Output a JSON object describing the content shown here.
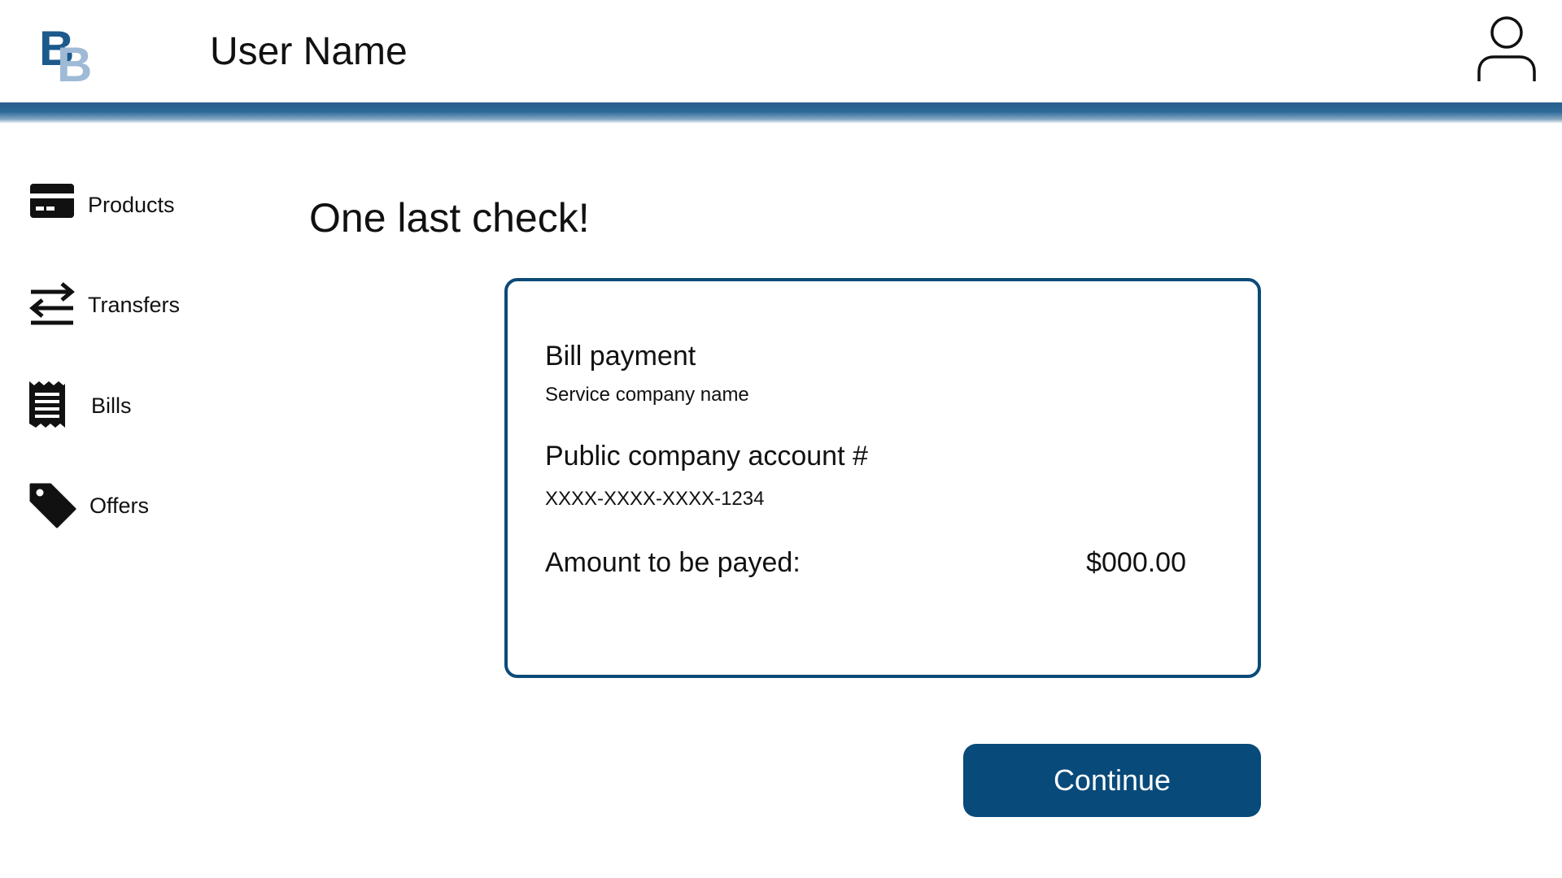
{
  "header": {
    "logo_text_primary": "B",
    "logo_text_secondary": "B",
    "user_name": "User Name",
    "profile_icon": "user-profile-icon"
  },
  "sidebar": {
    "items": [
      {
        "label": "Products",
        "icon": "credit-card-icon"
      },
      {
        "label": "Transfers",
        "icon": "transfer-arrows-icon"
      },
      {
        "label": "Bills",
        "icon": "receipt-icon"
      },
      {
        "label": "Offers",
        "icon": "tag-icon"
      }
    ]
  },
  "main": {
    "title": "One last check!",
    "card": {
      "payment_type": "Bill payment",
      "company_name": "Service company name",
      "account_label": "Public company account #",
      "account_number": "XXXX-XXXX-XXXX-1234",
      "amount_label": "Amount to be payed:",
      "amount_value": "$000.00"
    },
    "continue_label": "Continue"
  },
  "colors": {
    "primary": "#084a7a",
    "card_border": "#0b4a79",
    "header_bar": "#2e6a99",
    "logo_dark": "#1d5a8c",
    "logo_light": "#9fbad6"
  }
}
